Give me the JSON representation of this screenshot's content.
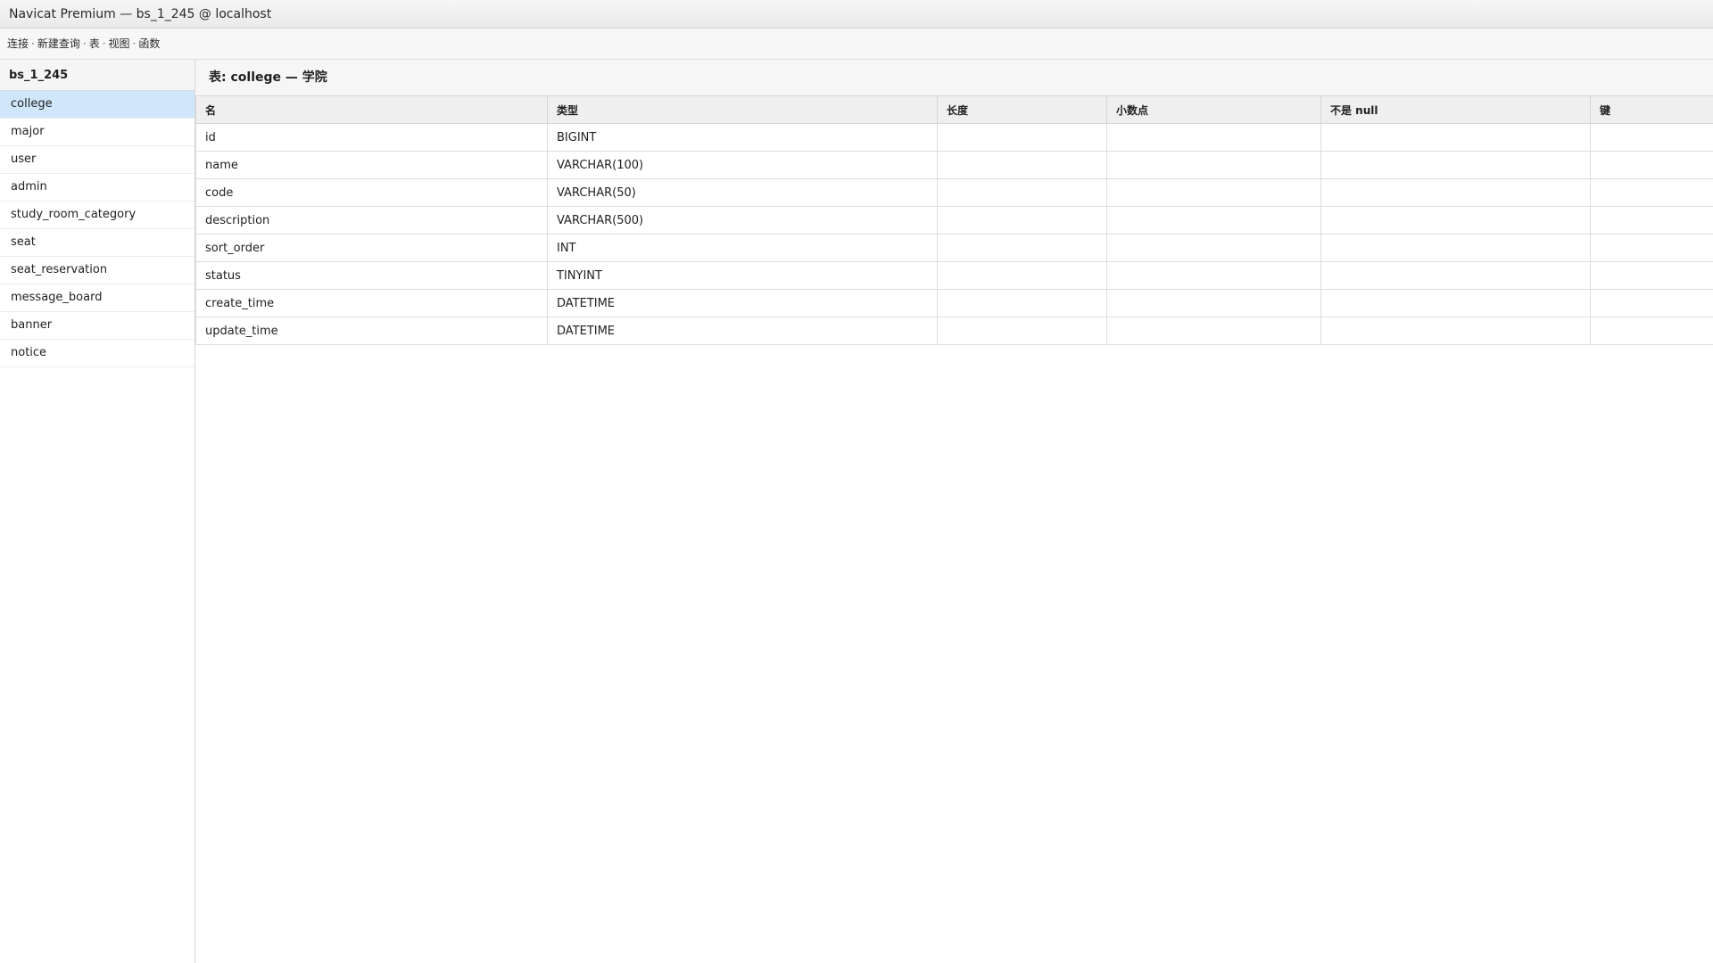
{
  "window": {
    "title": "Navicat Premium — bs_1_245 @ localhost"
  },
  "toolbar": {
    "items": [
      "连接",
      "新建查询",
      "表",
      "视图",
      "函数"
    ],
    "separator": "·"
  },
  "sidebar": {
    "database": "bs_1_245",
    "tables": [
      "college",
      "major",
      "user",
      "admin",
      "study_room_category",
      "seat",
      "seat_reservation",
      "message_board",
      "banner",
      "notice"
    ],
    "selected": "college"
  },
  "main": {
    "header": "表: college — 学院",
    "columns": [
      "名",
      "类型",
      "长度",
      "小数点",
      "不是 null",
      "键"
    ],
    "rows": [
      {
        "name": "id",
        "type": "BIGINT",
        "length": "",
        "decimals": "",
        "not_null": "",
        "key": ""
      },
      {
        "name": "name",
        "type": "VARCHAR(100)",
        "length": "",
        "decimals": "",
        "not_null": "",
        "key": ""
      },
      {
        "name": "code",
        "type": "VARCHAR(50)",
        "length": "",
        "decimals": "",
        "not_null": "",
        "key": ""
      },
      {
        "name": "description",
        "type": "VARCHAR(500)",
        "length": "",
        "decimals": "",
        "not_null": "",
        "key": ""
      },
      {
        "name": "sort_order",
        "type": "INT",
        "length": "",
        "decimals": "",
        "not_null": "",
        "key": ""
      },
      {
        "name": "status",
        "type": "TINYINT",
        "length": "",
        "decimals": "",
        "not_null": "",
        "key": ""
      },
      {
        "name": "create_time",
        "type": "DATETIME",
        "length": "",
        "decimals": "",
        "not_null": "",
        "key": ""
      },
      {
        "name": "update_time",
        "type": "DATETIME",
        "length": "",
        "decimals": "",
        "not_null": "",
        "key": ""
      }
    ]
  },
  "colors": {
    "selected_row": "#cfe6fb",
    "header_bg": "#efefef",
    "border": "#d6d6d6"
  }
}
